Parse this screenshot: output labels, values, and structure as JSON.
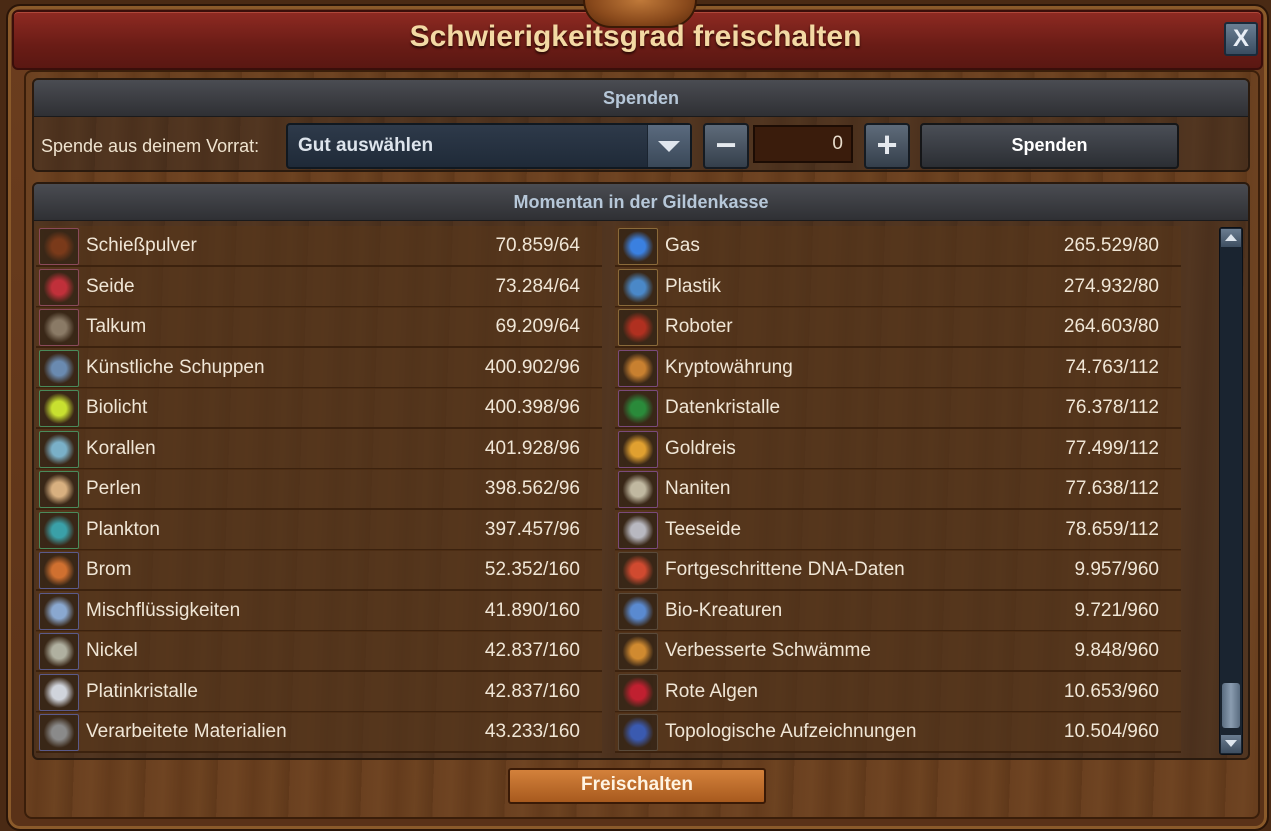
{
  "window": {
    "title": "Schwierigkeitsgrad freischalten",
    "close_label": "X"
  },
  "donate": {
    "header": "Spenden",
    "label": "Spende aus deinem Vorrat:",
    "select_value": "Gut auswählen",
    "minus": "−",
    "quantity": "0",
    "plus": "+",
    "button": "Spenden"
  },
  "treasury": {
    "header": "Momentan in der Gildenkasse",
    "left": [
      {
        "name": "Schießpulver",
        "value": "70.859/64",
        "icon": "gunpowder-icon",
        "color": "#7a3a1a",
        "border": "#8a4a5a"
      },
      {
        "name": "Seide",
        "value": "73.284/64",
        "icon": "silk-icon",
        "color": "#c0303a",
        "border": "#8a4a5a"
      },
      {
        "name": "Talkum",
        "value": "69.209/64",
        "icon": "talc-icon",
        "color": "#8a7a66",
        "border": "#8a4a5a"
      },
      {
        "name": "Künstliche Schuppen",
        "value": "400.902/96",
        "icon": "artificial-scales-icon",
        "color": "#6a8ab0",
        "border": "#4a8a5a"
      },
      {
        "name": "Biolicht",
        "value": "400.398/96",
        "icon": "biolight-icon",
        "color": "#c8e030",
        "border": "#4a8a5a"
      },
      {
        "name": "Korallen",
        "value": "401.928/96",
        "icon": "corals-icon",
        "color": "#7ab0c8",
        "border": "#4a8a5a"
      },
      {
        "name": "Perlen",
        "value": "398.562/96",
        "icon": "pearls-icon",
        "color": "#d8b080",
        "border": "#4a8a5a"
      },
      {
        "name": "Plankton",
        "value": "397.457/96",
        "icon": "plankton-icon",
        "color": "#3aa0a8",
        "border": "#4a8a5a"
      },
      {
        "name": "Brom",
        "value": "52.352/160",
        "icon": "bromine-icon",
        "color": "#d07030",
        "border": "#5a5a8a"
      },
      {
        "name": "Mischflüssigkeiten",
        "value": "41.890/160",
        "icon": "mixed-liquids-icon",
        "color": "#8aa8d0",
        "border": "#5a5a8a"
      },
      {
        "name": "Nickel",
        "value": "42.837/160",
        "icon": "nickel-icon",
        "color": "#b0b0a0",
        "border": "#5a5a8a"
      },
      {
        "name": "Platinkristalle",
        "value": "42.837/160",
        "icon": "platinum-crystals-icon",
        "color": "#d0d4dc",
        "border": "#5a5a8a"
      },
      {
        "name": "Verarbeitete Materialien",
        "value": "43.233/160",
        "icon": "processed-materials-icon",
        "color": "#8a8a8a",
        "border": "#5a5a8a"
      }
    ],
    "right": [
      {
        "name": "Gas",
        "value": "265.529/80",
        "icon": "gas-icon",
        "color": "#3a80e0",
        "border": "#8a6a3a"
      },
      {
        "name": "Plastik",
        "value": "274.932/80",
        "icon": "plastic-icon",
        "color": "#4a88c8",
        "border": "#8a6a3a"
      },
      {
        "name": "Roboter",
        "value": "264.603/80",
        "icon": "robot-icon",
        "color": "#b03020",
        "border": "#8a6a3a"
      },
      {
        "name": "Kryptowährung",
        "value": "74.763/112",
        "icon": "cryptocurrency-icon",
        "color": "#c88030",
        "border": "#7a4a7a"
      },
      {
        "name": "Datenkristalle",
        "value": "76.378/112",
        "icon": "data-crystals-icon",
        "color": "#2a8a3a",
        "border": "#7a4a7a"
      },
      {
        "name": "Goldreis",
        "value": "77.499/112",
        "icon": "golden-rice-icon",
        "color": "#e0a030",
        "border": "#7a4a7a"
      },
      {
        "name": "Naniten",
        "value": "77.638/112",
        "icon": "nanites-icon",
        "color": "#c0b8a0",
        "border": "#7a4a7a"
      },
      {
        "name": "Teeseide",
        "value": "78.659/112",
        "icon": "tea-silk-icon",
        "color": "#b8b8c0",
        "border": "#7a4a7a"
      },
      {
        "name": "Fortgeschrittene DNA-Daten",
        "value": "9.957/960",
        "icon": "advanced-dna-data-icon",
        "color": "#d04a30",
        "border": "#5a4a3a"
      },
      {
        "name": "Bio-Kreaturen",
        "value": "9.721/960",
        "icon": "bio-creatures-icon",
        "color": "#5a8ad0",
        "border": "#5a4a3a"
      },
      {
        "name": "Verbesserte Schwämme",
        "value": "9.848/960",
        "icon": "improved-sponges-icon",
        "color": "#d08a30",
        "border": "#5a4a3a"
      },
      {
        "name": "Rote Algen",
        "value": "10.653/960",
        "icon": "red-algae-icon",
        "color": "#c02030",
        "border": "#5a4a3a"
      },
      {
        "name": "Topologische Aufzeichnungen",
        "value": "10.504/960",
        "icon": "topological-records-icon",
        "color": "#3a5ab0",
        "border": "#5a4a3a"
      }
    ]
  },
  "footer": {
    "unlock_button": "Freischalten"
  }
}
